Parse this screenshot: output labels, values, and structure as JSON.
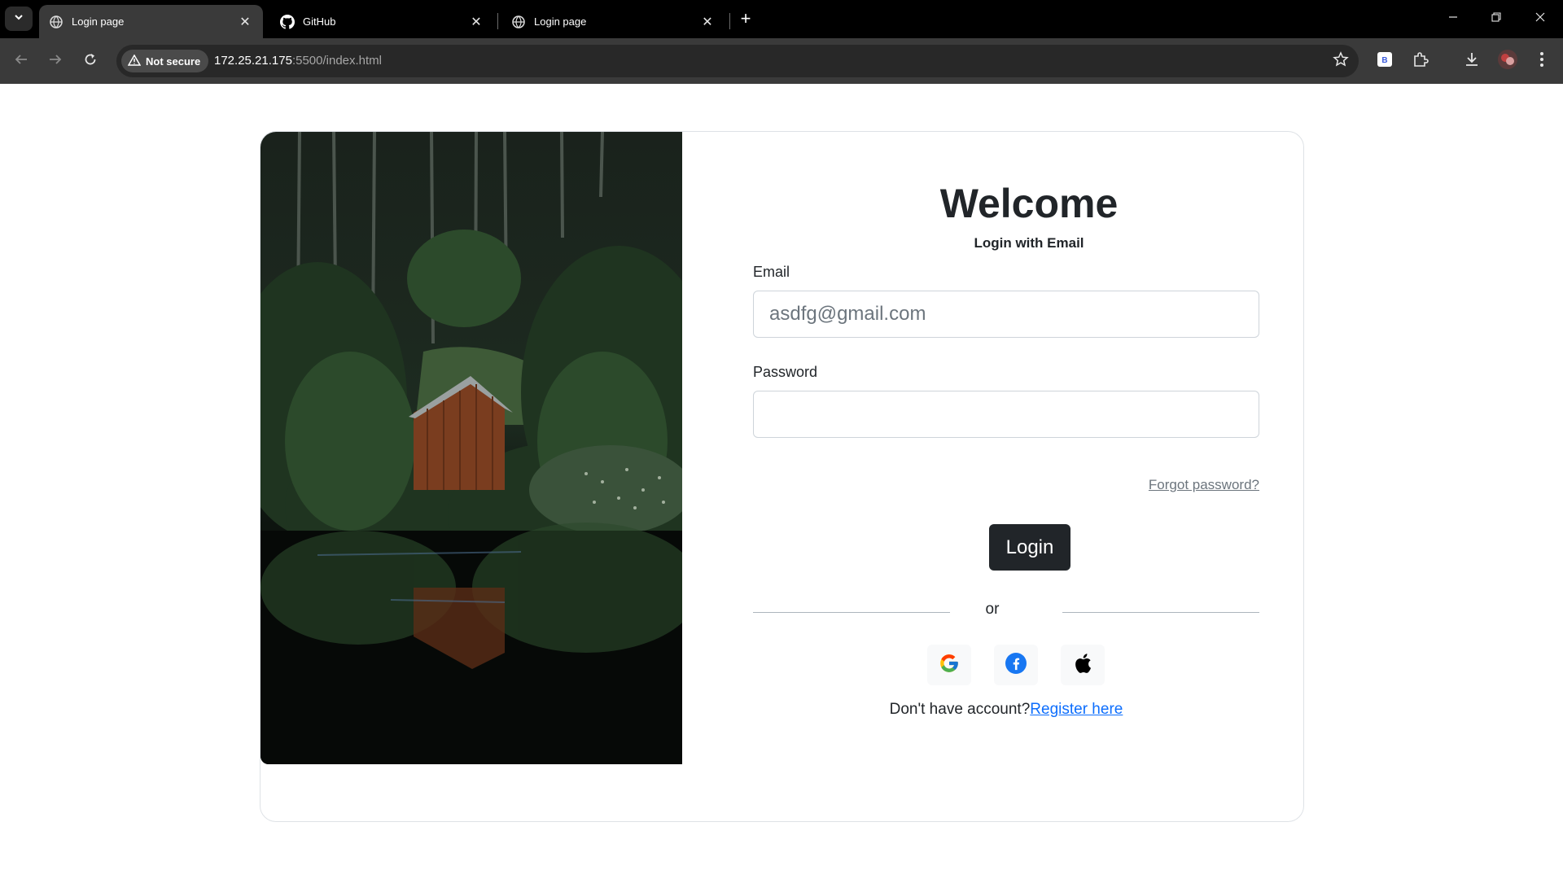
{
  "browser": {
    "tabs": [
      {
        "title": "Login page",
        "active": true
      },
      {
        "title": "GitHub",
        "active": false
      },
      {
        "title": "Login page",
        "active": false
      }
    ],
    "security_label": "Not secure",
    "url_host": "172.25.21.175",
    "url_path": ":5500/index.html"
  },
  "login": {
    "heading": "Welcome",
    "subheading": "Login with Email",
    "email_label": "Email",
    "email_placeholder": "asdfg@gmail.com",
    "password_label": "Password",
    "forgot_link": "Forgot password?",
    "submit_label": "Login",
    "divider_text": "or",
    "social_providers": [
      "google",
      "facebook",
      "apple"
    ],
    "register_prompt": "Don't have account?",
    "register_link": "Register here"
  },
  "colors": {
    "primary_button": "#212529",
    "link": "#0d6efd",
    "muted_link": "#6c757d",
    "facebook": "#1877f2"
  },
  "icons": [
    "chevron-down-icon",
    "globe-icon",
    "github-icon",
    "close-icon",
    "plus-icon",
    "minimize-icon",
    "restore-icon",
    "back-arrow-icon",
    "forward-arrow-icon",
    "reload-icon",
    "warning-icon",
    "star-icon",
    "extension-icon",
    "puzzle-icon",
    "download-icon",
    "avatar",
    "more-vert-icon",
    "google-icon",
    "facebook-icon",
    "apple-icon"
  ]
}
